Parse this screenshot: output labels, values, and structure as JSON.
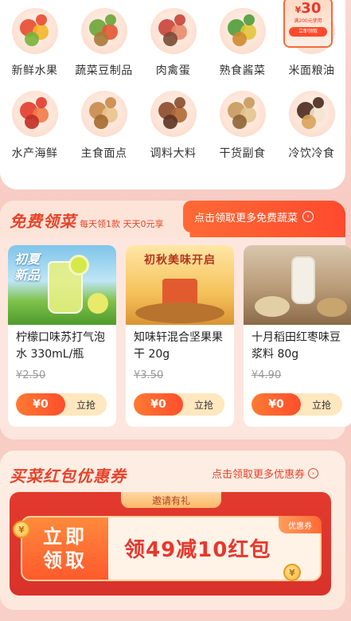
{
  "categories": [
    {
      "label": "新鲜水果",
      "icon": "fruit-icon",
      "colors": [
        "#e94a2f",
        "#f5b52c",
        "#79b33a"
      ]
    },
    {
      "label": "蔬菜豆制品",
      "icon": "vegetable-icon",
      "colors": [
        "#6aa536",
        "#e45532",
        "#a87a3a"
      ]
    },
    {
      "label": "肉禽蛋",
      "icon": "meat-icon",
      "colors": [
        "#c9423a",
        "#e8896b",
        "#7b4a35"
      ]
    },
    {
      "label": "熟食酱菜",
      "icon": "deli-icon",
      "colors": [
        "#4f9d3a",
        "#e2c43b",
        "#d0892f"
      ]
    },
    {
      "label": "米面粮油",
      "icon": "grain-icon",
      "colors": [
        "#e85a3a",
        "#f2d27a",
        "#ffffff"
      ]
    },
    {
      "label": "水产海鲜",
      "icon": "seafood-icon",
      "colors": [
        "#e23b2c",
        "#f07a48",
        "#c02d24"
      ]
    },
    {
      "label": "主食面点",
      "icon": "bread-icon",
      "colors": [
        "#c98a4a",
        "#e9c38b",
        "#a5692f"
      ]
    },
    {
      "label": "调料大料",
      "icon": "spice-icon",
      "colors": [
        "#8b4a2a",
        "#b06835",
        "#5e3320"
      ]
    },
    {
      "label": "干货副食",
      "icon": "dry-goods-icon",
      "colors": [
        "#c79a5e",
        "#e4c58f",
        "#8e6336"
      ]
    },
    {
      "label": "冷饮冷食",
      "icon": "ice-cream-icon",
      "colors": [
        "#4a2a1e",
        "#f4e6cf",
        "#d9a35a"
      ]
    }
  ],
  "corner_coupon": {
    "amount": "30",
    "currency": "¥",
    "condition": "满200元使用",
    "button": "立即领取"
  },
  "free_veg": {
    "title": "免费领菜",
    "subtitle": "每天领1款  天天0元享",
    "more": "点击领取更多免费蔬菜",
    "products": [
      {
        "name": "柠檬口味苏打气泡水 330mL/瓶",
        "orig_price": "¥2.50",
        "price": "¥0",
        "grab": "立抢",
        "img_text": "初夏\n新品",
        "theme": "lemon"
      },
      {
        "name": "知味轩混合坚果果干 20g",
        "orig_price": "¥3.50",
        "price": "¥0",
        "grab": "立抢",
        "img_text": "初秋美味开启",
        "theme": "nuts"
      },
      {
        "name": "十月稻田红枣味豆浆料 80g",
        "orig_price": "¥4.90",
        "price": "¥0",
        "grab": "立抢",
        "img_text": "",
        "theme": "soy"
      }
    ]
  },
  "red_packet": {
    "title": "买菜红包优惠券",
    "more": "点击领取更多优惠券",
    "invite": "邀请有礼",
    "left_line1": "立即",
    "left_line2": "领取",
    "main": "领49减10红包",
    "badge": "优惠券",
    "coin_symbol": "¥"
  }
}
